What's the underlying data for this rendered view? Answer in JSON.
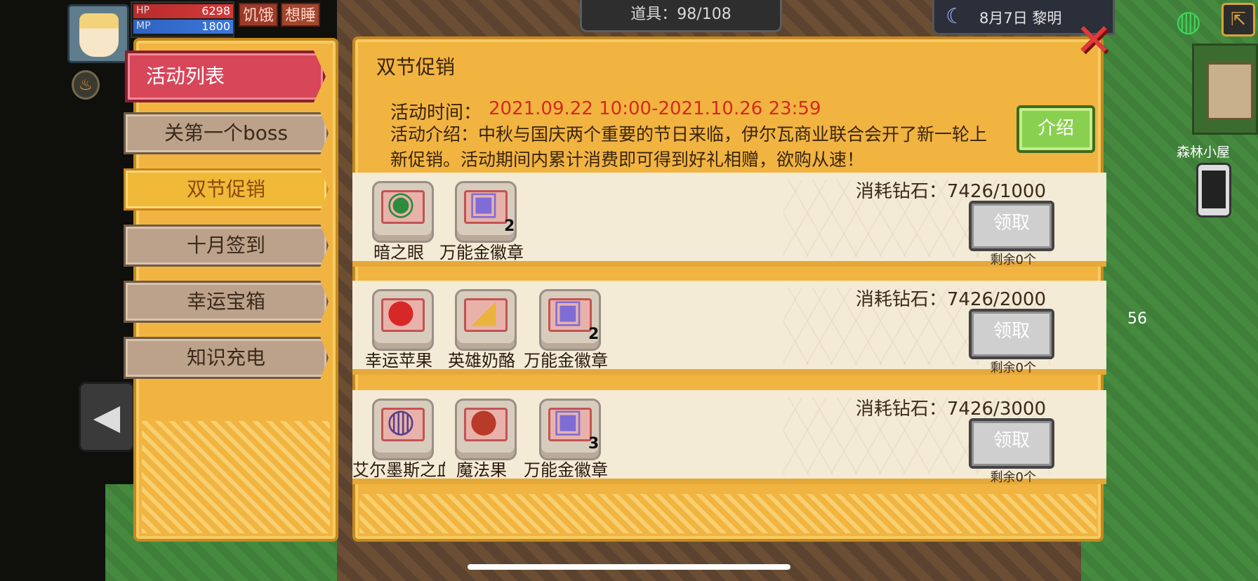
{
  "hud": {
    "hp_label": "HP",
    "hp_value": "6298",
    "mp_label": "MP",
    "mp_value": "1800",
    "status_hungry": "饥饿",
    "status_sleepy": "想睡"
  },
  "top_bar": {
    "items_count": "道具：98/108",
    "date": "8月7日  黎明"
  },
  "sidebar": {
    "title": "活动列表",
    "items": [
      {
        "label": "关第一个boss",
        "active": false
      },
      {
        "label": "双节促销",
        "active": true
      },
      {
        "label": "十月签到",
        "active": false
      },
      {
        "label": "幸运宝箱",
        "active": false
      },
      {
        "label": "知识充电",
        "active": false
      }
    ]
  },
  "event": {
    "title": "双节促销",
    "time_label": "活动时间：",
    "time_value": "2021.09.22 10:00-2021.10.26 23:59",
    "description": "活动介绍：中秋与国庆两个重要的节日来临，伊尔瓦商业联合会开了新一轮上新促销。活动期间内累计消费即可得到好礼相赠，欲购从速！",
    "intro_button": "介绍"
  },
  "rewards": [
    {
      "cost": "消耗钻石：7426/1000",
      "claim": "领取",
      "remaining": "剩余0个",
      "items": [
        {
          "name": "暗之眼",
          "count": "",
          "icon": "dark-eye-icon",
          "glyph": "◉",
          "color": "#2e8a3c"
        },
        {
          "name": "万能金徽章",
          "count": "2",
          "icon": "gold-badge-icon",
          "glyph": "▣",
          "color": "#7f6cd6"
        }
      ]
    },
    {
      "cost": "消耗钻石：7426/2000",
      "claim": "领取",
      "remaining": "剩余0个",
      "items": [
        {
          "name": "幸运苹果",
          "count": "",
          "icon": "apple-icon",
          "glyph": "●",
          "color": "#d72828"
        },
        {
          "name": "英雄奶酪",
          "count": "",
          "icon": "cheese-icon",
          "glyph": "◢",
          "color": "#e9b43c"
        },
        {
          "name": "万能金徽章",
          "count": "2",
          "icon": "gold-badge-icon",
          "glyph": "▣",
          "color": "#7f6cd6"
        }
      ]
    },
    {
      "cost": "消耗钻石：7426/3000",
      "claim": "领取",
      "remaining": "剩余0个",
      "items": [
        {
          "name": "艾尔墨斯之血",
          "count": "",
          "icon": "blood-flask-icon",
          "glyph": "◍",
          "color": "#5a3f8a"
        },
        {
          "name": "魔法果",
          "count": "",
          "icon": "magic-fruit-icon",
          "glyph": "●",
          "color": "#b83a28"
        },
        {
          "name": "万能金徽章",
          "count": "3",
          "icon": "gold-badge-icon",
          "glyph": "▣",
          "color": "#7f6cd6"
        }
      ]
    }
  ],
  "world": {
    "location": "森林小屋",
    "stack_count": "56"
  }
}
